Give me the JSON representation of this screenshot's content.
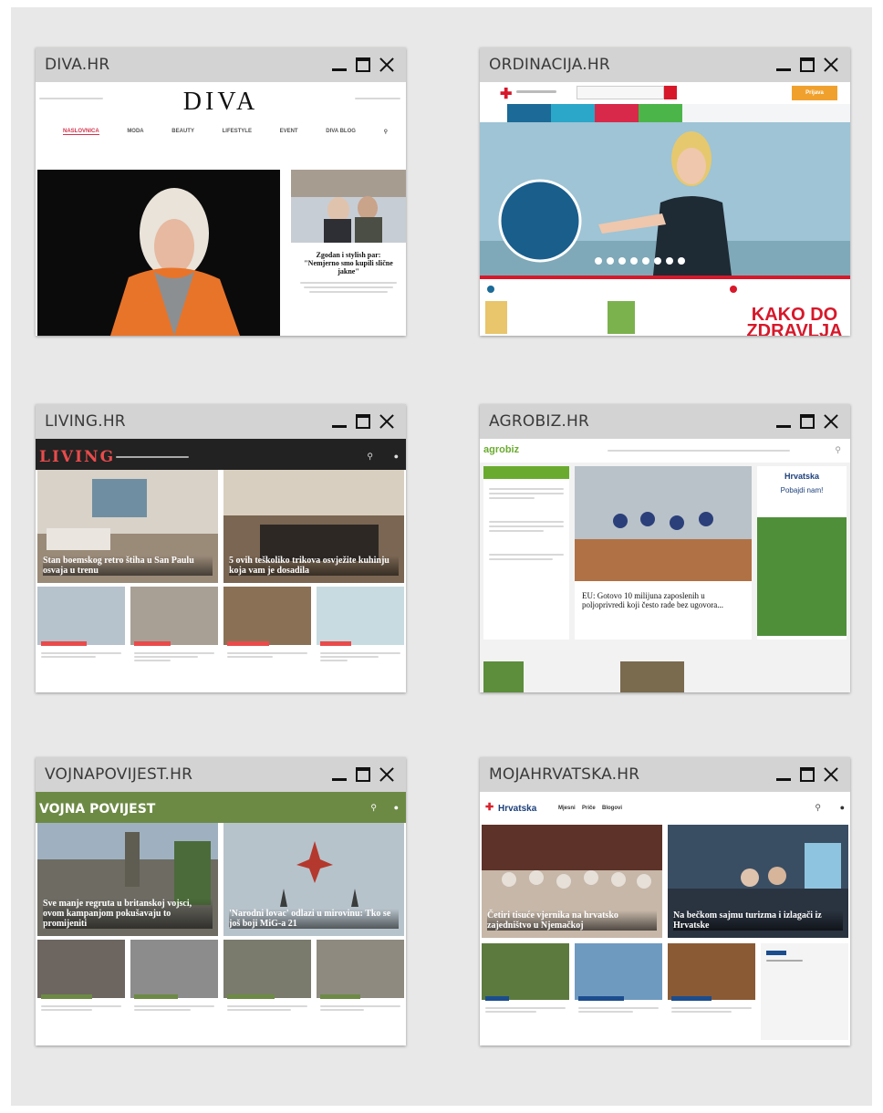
{
  "windows": [
    {
      "title": "DIVA.HR",
      "logo": "DIVA",
      "nav": [
        "NASLOVNICA",
        "MODA",
        "BEAUTY",
        "LIFESTYLE",
        "EVENT",
        "DIVA BLOG"
      ],
      "side_headline": "Zgodan i stylish par: \"Nemjerno smo kupili slične jakne\""
    },
    {
      "title": "ORDINACIJA.HR",
      "badge_button": "Prijava",
      "big_text": "KAKO DO ZDRAVLJA"
    },
    {
      "title": "LIVING.HR",
      "logo": "LIVING",
      "hero_left_caption": "Stan boemskog retro štiha u San Paulu osvaja u trenu",
      "hero_right_caption": "5 ovih teškoliko trikova osvježite kuhinju koja vam je dosadila"
    },
    {
      "title": "AGROBIZ.HR",
      "logo": "agrobiz",
      "hero_caption": "EU: Gotovo 10 milijuna zaposlenih u poljoprivredi koji često rade bez ugovora...",
      "ad_brand": "Hrvatska",
      "ad_headline": "Pobajdi nam!"
    },
    {
      "title": "VOJNAPOVIJEST.HR",
      "logo": "VOJNA POVIJEST",
      "hero_left_caption": "Sve manje regruta u britanskoj vojsci, ovom kampanjom pokušavaju to promijeniti",
      "hero_right_caption": "'Narodni lovac' odlazi u mirovinu: Tko se još boji MiG-a 21"
    },
    {
      "title": "MOJAHRVATSKA.HR",
      "logo": "Hrvatska",
      "nav": [
        "Mjesni",
        "Priče",
        "Blogovi"
      ],
      "hero_left_caption": "Četiri tisuće vjernika na hrvatsko zajedništvo u Njemačkoj",
      "hero_right_caption": "Na bečkom sajmu turizma i izlagači iz Hrvatske"
    }
  ],
  "colors": {
    "panel": "#e8e8e9",
    "titlebar": "#d3d3d4",
    "diva_accent": "#d2344c",
    "ordinacija_red": "#d7182a",
    "living_bar": "#222222",
    "agro_green": "#6aab2f",
    "vojna_green": "#6d8a45",
    "moja_red": "#d9232e"
  },
  "icons": [
    "minimize-icon",
    "maximize-icon",
    "close-icon"
  ]
}
